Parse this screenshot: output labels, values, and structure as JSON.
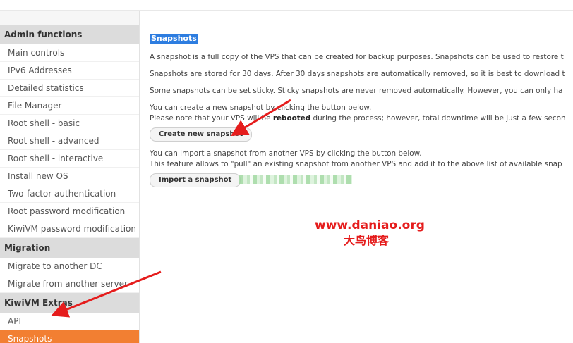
{
  "sidebar": {
    "sections": [
      {
        "title": "Admin functions",
        "items": [
          {
            "label": "Main controls"
          },
          {
            "label": "IPv6 Addresses"
          },
          {
            "label": "Detailed statistics"
          },
          {
            "label": "File Manager"
          },
          {
            "label": "Root shell - basic"
          },
          {
            "label": "Root shell - advanced"
          },
          {
            "label": "Root shell - interactive"
          },
          {
            "label": "Install new OS"
          },
          {
            "label": "Two-factor authentication"
          },
          {
            "label": "Root password modification"
          },
          {
            "label": "KiwiVM password modification"
          }
        ]
      },
      {
        "title": "Migration",
        "items": [
          {
            "label": "Migrate to another DC"
          },
          {
            "label": "Migrate from another server"
          }
        ]
      },
      {
        "title": "KiwiVM Extras",
        "items": [
          {
            "label": "API"
          },
          {
            "label": "Snapshots",
            "active": true
          }
        ]
      }
    ]
  },
  "main": {
    "title": "Snapshots",
    "p1": "A snapshot is a full copy of the VPS that can be created for backup purposes. Snapshots can be used to restore t",
    "p2": "Snapshots are stored for 30 days. After 30 days snapshots are automatically removed, so it is best to download t",
    "p3": "Some snapshots can be set sticky. Sticky snapshots are never removed automatically. However, you can only ha",
    "p4_line1": "You can create a new snapshot by clicking the button below.",
    "p4_line2_before": "Please note that your VPS will be ",
    "p4_line2_bold": "rebooted",
    "p4_line2_after": " during the process; however, total downtime will be just a few secon",
    "create_button": "Create new snapshot",
    "p5_line1": "You can import a snapshot from another VPS by clicking the button below.",
    "p5_line2": "This feature allows to \"pull\" an existing snapshot from another VPS and add it to the above list of available snap",
    "import_button": "Import a snapshot"
  },
  "watermark": {
    "url": "www.daniao.org",
    "cn": "大鸟博客",
    "color": "#e51c1c"
  },
  "colors": {
    "accent": "#f27f32",
    "title_highlight": "#2d7de0",
    "arrow": "#e51c1c"
  }
}
